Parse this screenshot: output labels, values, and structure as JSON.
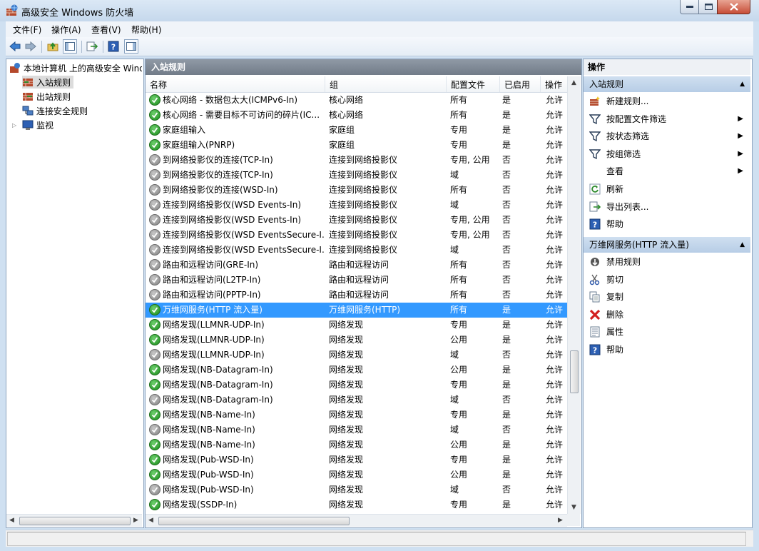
{
  "window": {
    "title": "高级安全 Windows 防火墙",
    "icon": "firewall-icon"
  },
  "menu": [
    "文件(F)",
    "操作(A)",
    "查看(V)",
    "帮助(H)"
  ],
  "tree": {
    "root": "本地计算机 上的高级安全 Windows",
    "items": [
      "入站规则",
      "出站规则",
      "连接安全规则",
      "监视"
    ],
    "selected": "入站规则"
  },
  "center": {
    "header": "入站规则",
    "columns": [
      "名称",
      "组",
      "配置文件",
      "已启用",
      "操作"
    ],
    "rows": [
      {
        "name": "核心网络 - 数据包太大(ICMPv6-In)",
        "group": "核心网络",
        "profile": "所有",
        "enabled": "是",
        "action": "允许",
        "on": true
      },
      {
        "name": "核心网络 - 需要目标不可访问的碎片(IC...",
        "group": "核心网络",
        "profile": "所有",
        "enabled": "是",
        "action": "允许",
        "on": true
      },
      {
        "name": "家庭组输入",
        "group": "家庭组",
        "profile": "专用",
        "enabled": "是",
        "action": "允许",
        "on": true
      },
      {
        "name": "家庭组输入(PNRP)",
        "group": "家庭组",
        "profile": "专用",
        "enabled": "是",
        "action": "允许",
        "on": true
      },
      {
        "name": "到网络投影仪的连接(TCP-In)",
        "group": "连接到网络投影仪",
        "profile": "专用, 公用",
        "enabled": "否",
        "action": "允许",
        "on": false
      },
      {
        "name": "到网络投影仪的连接(TCP-In)",
        "group": "连接到网络投影仪",
        "profile": "域",
        "enabled": "否",
        "action": "允许",
        "on": false
      },
      {
        "name": "到网络投影仪的连接(WSD-In)",
        "group": "连接到网络投影仪",
        "profile": "所有",
        "enabled": "否",
        "action": "允许",
        "on": false
      },
      {
        "name": "连接到网络投影仪(WSD Events-In)",
        "group": "连接到网络投影仪",
        "profile": "域",
        "enabled": "否",
        "action": "允许",
        "on": false
      },
      {
        "name": "连接到网络投影仪(WSD Events-In)",
        "group": "连接到网络投影仪",
        "profile": "专用, 公用",
        "enabled": "否",
        "action": "允许",
        "on": false
      },
      {
        "name": "连接到网络投影仪(WSD EventsSecure-I...",
        "group": "连接到网络投影仪",
        "profile": "专用, 公用",
        "enabled": "否",
        "action": "允许",
        "on": false
      },
      {
        "name": "连接到网络投影仪(WSD EventsSecure-I...",
        "group": "连接到网络投影仪",
        "profile": "域",
        "enabled": "否",
        "action": "允许",
        "on": false
      },
      {
        "name": "路由和远程访问(GRE-In)",
        "group": "路由和远程访问",
        "profile": "所有",
        "enabled": "否",
        "action": "允许",
        "on": false
      },
      {
        "name": "路由和远程访问(L2TP-In)",
        "group": "路由和远程访问",
        "profile": "所有",
        "enabled": "否",
        "action": "允许",
        "on": false
      },
      {
        "name": "路由和远程访问(PPTP-In)",
        "group": "路由和远程访问",
        "profile": "所有",
        "enabled": "否",
        "action": "允许",
        "on": false
      },
      {
        "name": "万维网服务(HTTP 流入量)",
        "group": "万维网服务(HTTP)",
        "profile": "所有",
        "enabled": "是",
        "action": "允许",
        "on": true,
        "selected": true
      },
      {
        "name": "网络发现(LLMNR-UDP-In)",
        "group": "网络发现",
        "profile": "专用",
        "enabled": "是",
        "action": "允许",
        "on": true
      },
      {
        "name": "网络发现(LLMNR-UDP-In)",
        "group": "网络发现",
        "profile": "公用",
        "enabled": "是",
        "action": "允许",
        "on": true
      },
      {
        "name": "网络发现(LLMNR-UDP-In)",
        "group": "网络发现",
        "profile": "域",
        "enabled": "否",
        "action": "允许",
        "on": false
      },
      {
        "name": "网络发现(NB-Datagram-In)",
        "group": "网络发现",
        "profile": "公用",
        "enabled": "是",
        "action": "允许",
        "on": true
      },
      {
        "name": "网络发现(NB-Datagram-In)",
        "group": "网络发现",
        "profile": "专用",
        "enabled": "是",
        "action": "允许",
        "on": true
      },
      {
        "name": "网络发现(NB-Datagram-In)",
        "group": "网络发现",
        "profile": "域",
        "enabled": "否",
        "action": "允许",
        "on": false
      },
      {
        "name": "网络发现(NB-Name-In)",
        "group": "网络发现",
        "profile": "专用",
        "enabled": "是",
        "action": "允许",
        "on": true
      },
      {
        "name": "网络发现(NB-Name-In)",
        "group": "网络发现",
        "profile": "域",
        "enabled": "否",
        "action": "允许",
        "on": false
      },
      {
        "name": "网络发现(NB-Name-In)",
        "group": "网络发现",
        "profile": "公用",
        "enabled": "是",
        "action": "允许",
        "on": true
      },
      {
        "name": "网络发现(Pub-WSD-In)",
        "group": "网络发现",
        "profile": "专用",
        "enabled": "是",
        "action": "允许",
        "on": true
      },
      {
        "name": "网络发现(Pub-WSD-In)",
        "group": "网络发现",
        "profile": "公用",
        "enabled": "是",
        "action": "允许",
        "on": true
      },
      {
        "name": "网络发现(Pub-WSD-In)",
        "group": "网络发现",
        "profile": "域",
        "enabled": "否",
        "action": "允许",
        "on": false
      },
      {
        "name": "网络发现(SSDP-In)",
        "group": "网络发现",
        "profile": "专用",
        "enabled": "是",
        "action": "允许",
        "on": true
      }
    ]
  },
  "actions": {
    "header": "操作",
    "section1": {
      "title": "入站规则",
      "items": [
        "新建规则...",
        "按配置文件筛选",
        "按状态筛选",
        "按组筛选",
        "查看",
        "刷新",
        "导出列表...",
        "帮助"
      ]
    },
    "section2": {
      "title": "万维网服务(HTTP 流入量)",
      "items": [
        "禁用规则",
        "剪切",
        "复制",
        "删除",
        "属性",
        "帮助"
      ]
    }
  }
}
